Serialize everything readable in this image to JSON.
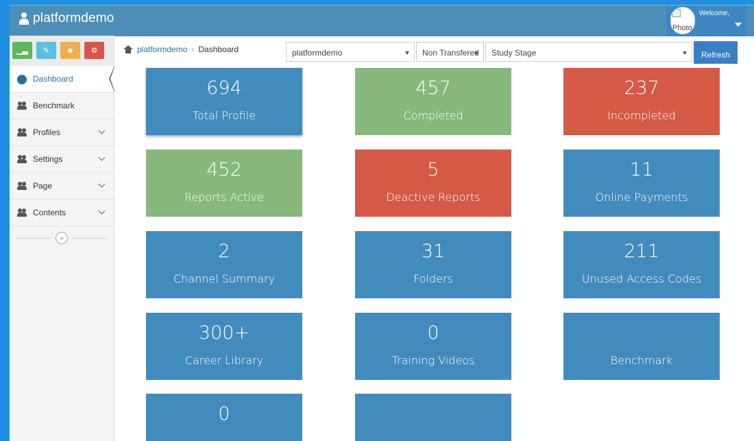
{
  "topbar": {
    "brand": "platformdemo",
    "photo_alt": "Photo",
    "welcome": "Welcome,"
  },
  "sidebar": {
    "buttons": [
      {
        "icon": "bar-chart-icon",
        "color": "#5cb85c"
      },
      {
        "icon": "pencil-icon",
        "color": "#5bc0de"
      },
      {
        "icon": "users-icon",
        "color": "#f0ad4e"
      },
      {
        "icon": "cogs-icon",
        "color": "#d9534f"
      }
    ],
    "items": [
      {
        "label": "Dashboard",
        "icon": "dashboard-icon",
        "expandable": false,
        "active": true
      },
      {
        "label": "Benchmark",
        "icon": "users-icon",
        "expandable": false,
        "active": false
      },
      {
        "label": "Profiles",
        "icon": "users-icon",
        "expandable": true,
        "active": false
      },
      {
        "label": "Settings",
        "icon": "users-icon",
        "expandable": true,
        "active": false
      },
      {
        "label": "Page",
        "icon": "users-icon",
        "expandable": true,
        "active": false
      },
      {
        "label": "Contents",
        "icon": "users-icon",
        "expandable": true,
        "active": false
      }
    ],
    "collapse_glyph": "«"
  },
  "breadcrumb": {
    "home": "platformdemo",
    "separator": "›",
    "current": "Dashboard"
  },
  "filters": {
    "organization": "platformdemo",
    "transfer": "Non Transfered",
    "stage": "Study Stage",
    "refresh_label": "Refresh"
  },
  "tiles": [
    {
      "value": "694",
      "label": "Total Profile",
      "color": "#428bbd"
    },
    {
      "value": "457",
      "label": "Completed",
      "color": "#88b87c"
    },
    {
      "value": "237",
      "label": "Incompleted",
      "color": "#d45a45"
    },
    {
      "value": "452",
      "label": "Reports Active",
      "color": "#88b87c"
    },
    {
      "value": "5",
      "label": "Deactive Reports",
      "color": "#d45a45"
    },
    {
      "value": "11",
      "label": "Online Payments",
      "color": "#428bbd"
    },
    {
      "value": "2",
      "label": "Channel Summary",
      "color": "#428bbd"
    },
    {
      "value": "31",
      "label": "Folders",
      "color": "#428bbd"
    },
    {
      "value": "211",
      "label": "Unused Access Codes",
      "color": "#428bbd"
    },
    {
      "value": "300+",
      "label": "Career Library",
      "color": "#428bbd"
    },
    {
      "value": "0",
      "label": "Training Videos",
      "color": "#428bbd"
    },
    {
      "value": "",
      "label": "Benchmark",
      "color": "#428bbd"
    },
    {
      "value": "0",
      "label": "",
      "color": "#428bbd"
    },
    {
      "value": "",
      "label": "",
      "color": "#428bbd"
    }
  ]
}
